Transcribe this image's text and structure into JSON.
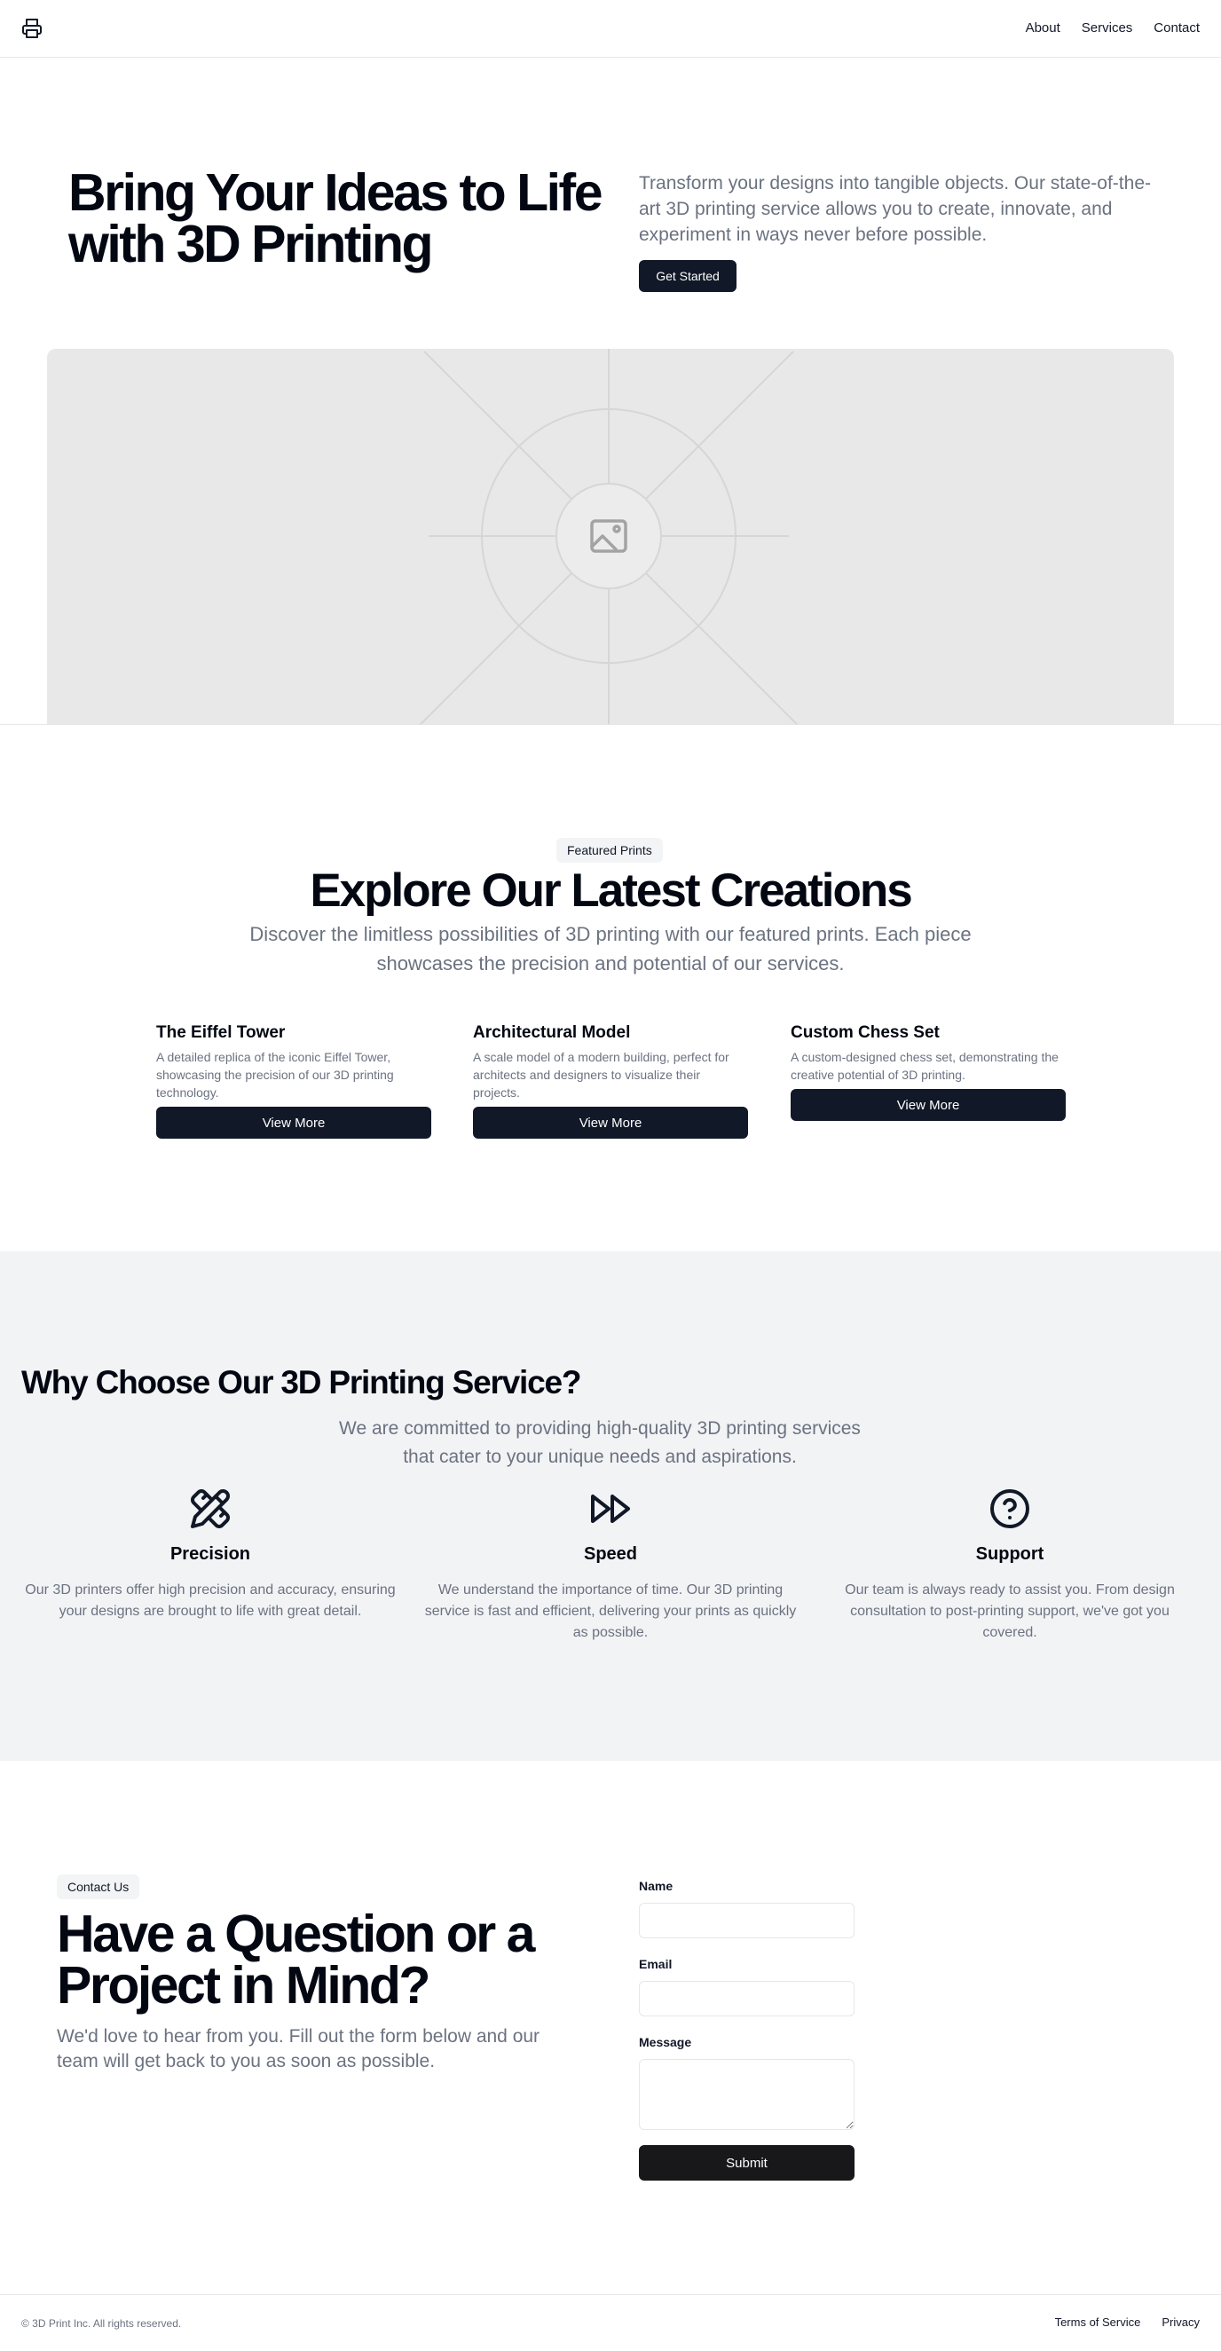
{
  "header": {
    "logo_icon": "printer-icon",
    "nav": [
      "About",
      "Services",
      "Contact"
    ]
  },
  "hero": {
    "title": "Bring Your Ideas to Life with 3D Printing",
    "text": "Transform your designs into tangible objects. Our state-of-the-art 3D printing service allows you to create, innovate, and experiment in ways never before possible.",
    "cta": "Get Started",
    "image_icon": "image-placeholder-icon"
  },
  "featured": {
    "badge": "Featured Prints",
    "title": "Explore Our Latest Creations",
    "text": "Discover the limitless possibilities of 3D printing with our featured prints. Each piece showcases the precision and potential of our services.",
    "cards": [
      {
        "title": "The Eiffel Tower",
        "desc": "A detailed replica of the iconic Eiffel Tower, showcasing the precision of our 3D printing technology.",
        "button": "View More"
      },
      {
        "title": "Architectural Model",
        "desc": "A scale model of a modern building, perfect for architects and designers to visualize their projects.",
        "button": "View More"
      },
      {
        "title": "Custom Chess Set",
        "desc": "A custom-designed chess set, demonstrating the creative potential of 3D printing.",
        "button": "View More"
      }
    ]
  },
  "why": {
    "title": "Why Choose Our 3D Printing Service?",
    "text": "We are committed to providing high-quality 3D printing services that cater to your unique needs and aspirations.",
    "features": [
      {
        "icon": "pencil-ruler-icon",
        "title": "Precision",
        "text": "Our 3D printers offer high precision and accuracy, ensuring your designs are brought to life with great detail."
      },
      {
        "icon": "fast-forward-icon",
        "title": "Speed",
        "text": "We understand the importance of time. Our 3D printing service is fast and efficient, delivering your prints as quickly as possible."
      },
      {
        "icon": "help-circle-icon",
        "title": "Support",
        "text": "Our team is always ready to assist you. From design consultation to post-printing support, we've got you covered."
      }
    ]
  },
  "contact": {
    "badge": "Contact Us",
    "title": "Have a Question or a Project in Mind?",
    "text": "We'd love to hear from you. Fill out the form below and our team will get back to you as soon as possible.",
    "labels": {
      "name": "Name",
      "email": "Email",
      "message": "Message"
    },
    "values": {
      "name": "",
      "email": "",
      "message": ""
    },
    "submit": "Submit"
  },
  "footer": {
    "copyright": "© 3D Print Inc. All rights reserved.",
    "links": [
      "Terms of Service",
      "Privacy"
    ]
  },
  "colors": {
    "primary": "#111827",
    "muted_text": "#6b7280",
    "section_bg": "#f2f3f5",
    "placeholder_bg": "#e8e8e8",
    "border": "#e5e7eb"
  }
}
